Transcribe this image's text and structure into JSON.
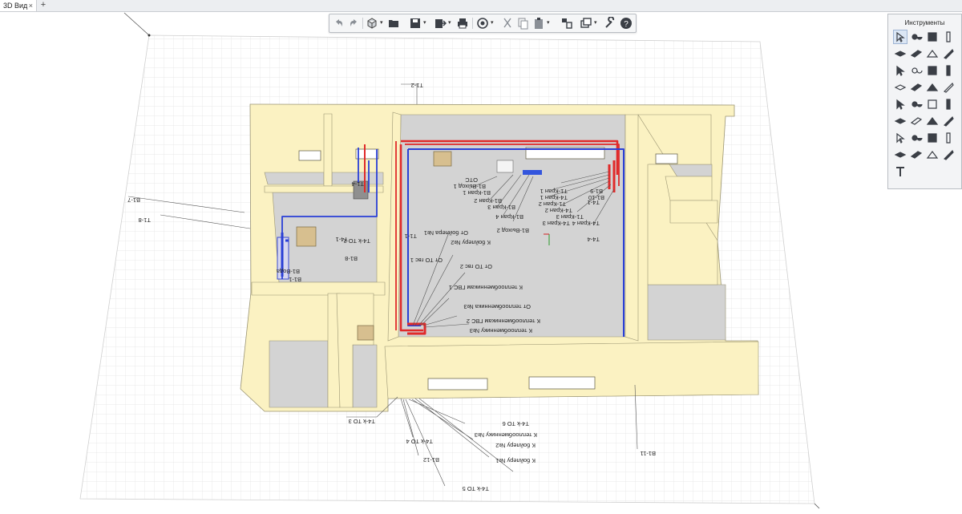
{
  "tab": {
    "title": "3D Вид",
    "close": "×",
    "add": "+"
  },
  "toolbar": {
    "buttons": [
      "undo-icon",
      "redo-icon",
      "cube-view-icon",
      "open-folder-icon",
      "save-icon",
      "export-icon",
      "print-icon",
      "render-icon",
      "cut-icon",
      "copy-icon",
      "paste-icon",
      "layers-icon",
      "views-icon",
      "wrench-icon",
      "help-icon"
    ],
    "dropdown": "▾"
  },
  "palette": {
    "title": "Инструменты",
    "tools": [
      [
        "pointer-icon",
        "node-icon",
        "wall-icon",
        "column-icon"
      ],
      [
        "slab-icon",
        "beam-icon",
        "roof-icon",
        "ruler-icon"
      ],
      [
        "floor-icon",
        "stair-icon",
        "door-icon",
        "window-icon"
      ],
      [
        "railing-icon",
        "line-icon",
        "toilet-icon",
        "tap-icon"
      ],
      [
        "boiler-icon",
        "radiator-icon",
        "pump-icon",
        "valve-icon"
      ],
      [
        "fitting-icon",
        "manifold-icon",
        "tee-icon",
        "filter-icon"
      ],
      [
        "heater-icon",
        "sink-icon",
        "meter-icon",
        "bath-icon"
      ],
      [
        "switch-icon",
        "shower-icon",
        "pipe-tool-icon",
        "duct-icon"
      ],
      [
        "text-icon"
      ]
    ]
  },
  "labels": {
    "top": [
      "T1-2",
      "B1-7",
      "T1-8",
      "B1-8",
      "T4-k TO 2",
      "T4-1",
      "T1-1",
      "B1-1",
      "B1-Вода",
      "T1-4"
    ],
    "risers": [
      "B1-Выход 1",
      "B1-Кран 1",
      "B1-Кран 2",
      "B1-Кран 3",
      "B1-Кран 4",
      "B1-Выход 2",
      "T1-Кран 1",
      "T1-Кран 2",
      "T1-Кран 3",
      "T4-Кран 1",
      "T4-Кран 2",
      "T4-Кран 3",
      "T4-Кран 4",
      "T4-4",
      "OTC",
      "T4-1",
      "B1-9",
      "B1-10"
    ],
    "center": [
      "От бойлера №1",
      "К бойлеру №2",
      "От ТО гвс 1",
      "От ТО гвс 2",
      "К теплообменникам ГВС 1",
      "От теплообменника №3",
      "К теплообменникам ГВС 2",
      "К теплообменнику №3"
    ],
    "bottom": [
      "T4-k TO 3",
      "T4-k TO 4",
      "B1-12",
      "T4-k TO 5",
      "T4-k TO 6",
      "К теплообменнику №3",
      "К бойлеру №2",
      "К бойлеру №1",
      "B1-11"
    ]
  },
  "colors": {
    "wall": "#fbf2c2",
    "wall_edge": "#9a9472",
    "floor": "#d3d3d3",
    "grid": "#e2e2e2",
    "hot_pipe": "#e02a2a",
    "cold_pipe": "#2a3fd6",
    "accent": "#2f6fc8"
  }
}
